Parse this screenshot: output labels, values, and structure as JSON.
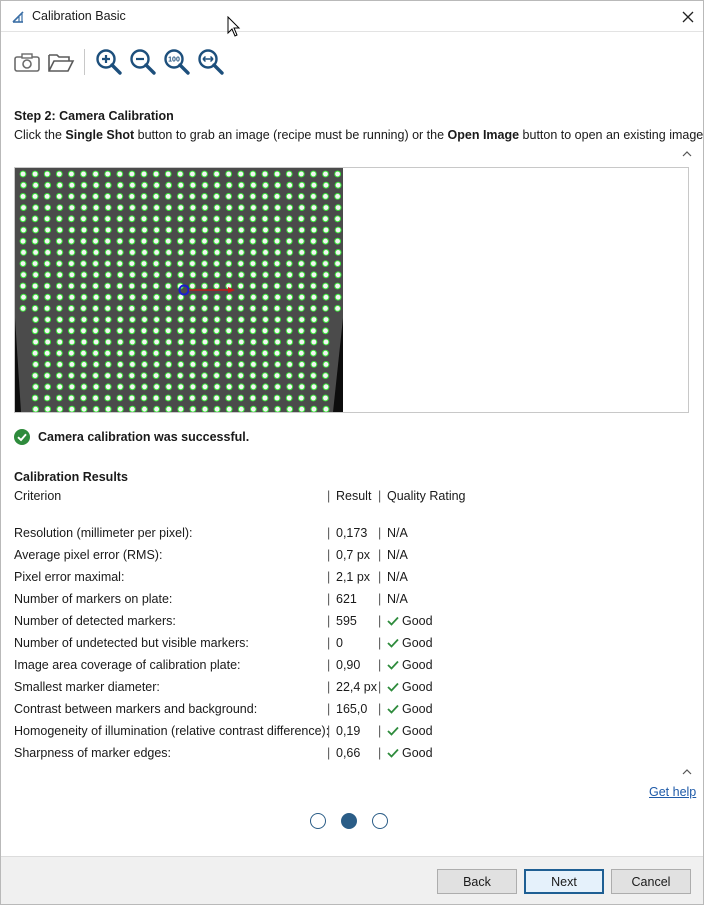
{
  "window": {
    "title": "Calibration Basic"
  },
  "toolbar": {
    "items": [
      {
        "name": "single-shot-button",
        "icon": "camera-icon"
      },
      {
        "name": "open-image-button",
        "icon": "folder-open-icon"
      },
      {
        "name": "zoom-in-button",
        "icon": "zoom-in-icon"
      },
      {
        "name": "zoom-out-button",
        "icon": "zoom-out-icon"
      },
      {
        "name": "zoom-100-button",
        "icon": "zoom-100-icon",
        "label": "100"
      },
      {
        "name": "zoom-fit-button",
        "icon": "zoom-fit-icon"
      }
    ]
  },
  "step": {
    "title": "Step 2: Camera Calibration",
    "desc_1": "Click the ",
    "desc_bold_1": "Single Shot",
    "desc_2": " button to grab an image (recipe must be running) or the ",
    "desc_bold_2": "Open Image",
    "desc_3": " button to open an existing image."
  },
  "status": {
    "message": "Camera calibration was successful.",
    "color": "#2e8b3c"
  },
  "results": {
    "title": "Calibration Results",
    "header": {
      "criterion": "Criterion",
      "result": "Result",
      "quality": "Quality Rating",
      "sep": "|"
    },
    "rows": [
      {
        "criterion": "Resolution (millimeter per pixel):",
        "result": "0,173",
        "quality": "N/A",
        "check": false
      },
      {
        "criterion": "Average pixel error (RMS):",
        "result": "0,7 px",
        "quality": "N/A",
        "check": false
      },
      {
        "criterion": "Pixel error maximal:",
        "result": "2,1 px",
        "quality": "N/A",
        "check": false
      },
      {
        "criterion": "Number of markers on plate:",
        "result": "621",
        "quality": "N/A",
        "check": false
      },
      {
        "criterion": "Number of detected markers:",
        "result": "595",
        "quality": "Good",
        "check": true
      },
      {
        "criterion": "Number of undetected but visible markers:",
        "result": "0",
        "quality": "Good",
        "check": true
      },
      {
        "criterion": "Image area coverage of calibration plate:",
        "result": "0,90",
        "quality": "Good",
        "check": true
      },
      {
        "criterion": "Smallest marker diameter:",
        "result": "22,4 px",
        "quality": "Good",
        "check": true
      },
      {
        "criterion": "Contrast between markers and background:",
        "result": "165,0",
        "quality": "Good",
        "check": true
      },
      {
        "criterion": "Homogeneity of illumination (relative contrast difference):",
        "result": "0,19",
        "quality": "Good",
        "check": true
      },
      {
        "criterion": "Sharpness of marker edges:",
        "result": "0,66",
        "quality": "Good",
        "check": true
      }
    ]
  },
  "help": {
    "label": "Get help"
  },
  "pager": {
    "total": 3,
    "current": 2
  },
  "footer": {
    "back": "Back",
    "next": "Next",
    "cancel": "Cancel"
  },
  "colors": {
    "accent": "#2b5d87",
    "good": "#2e8b3c",
    "link": "#1e5aa8",
    "marker_detected": "#39e639"
  }
}
